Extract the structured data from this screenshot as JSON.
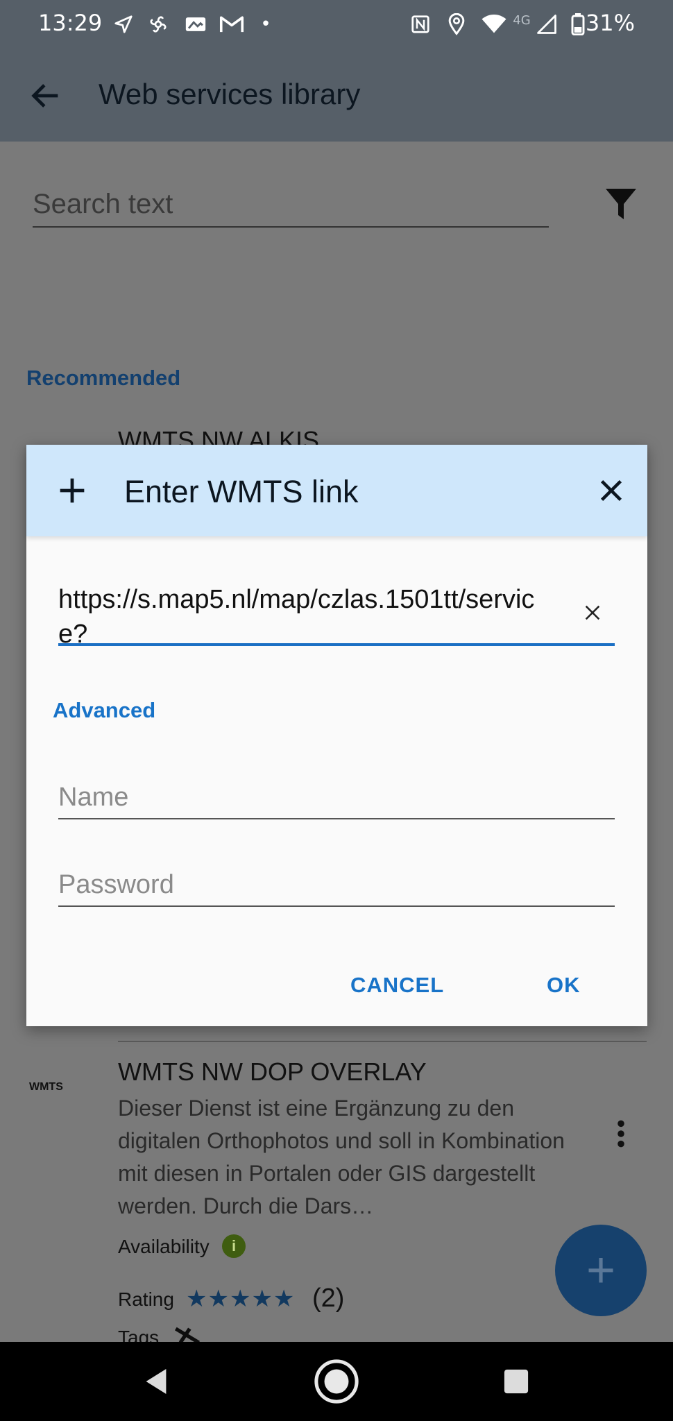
{
  "status_bar": {
    "time": "13:29",
    "network": "4G",
    "battery": "31%",
    "notif_dot": "•"
  },
  "app_bar": {
    "title": "Web services library"
  },
  "background": {
    "search_placeholder": "Search text",
    "section_title": "Recommended",
    "item1_title": "WMTS NW ALKIS",
    "item2_badge": "WMTS",
    "item2_title": "WMTS NW DOP OVERLAY",
    "item2_desc": "Dieser Dienst ist eine Ergänzung zu den digitalen Orthophotos und soll in Kombination mit diesen in Portalen oder GIS dargestellt werden. Durch die Dars…",
    "availability_label": "Availability",
    "availability_icon": "i",
    "rating_label": "Rating",
    "rating_stars": "★★★★★",
    "rating_value": 5,
    "rating_count": "(2)",
    "tags_label": "Tags",
    "fab_label": "+"
  },
  "dialog": {
    "title": "Enter WMTS link",
    "url_value": "https://s.map5.nl/map/czlas.1501tt/service?",
    "advanced_label": "Advanced",
    "name_placeholder": "Name",
    "password_placeholder": "Password",
    "cancel_label": "CANCEL",
    "ok_label": "OK"
  },
  "colors": {
    "accent": "#1873c8",
    "header_bg": "#cfe7fb",
    "app_bar_bg": "#565f68"
  }
}
